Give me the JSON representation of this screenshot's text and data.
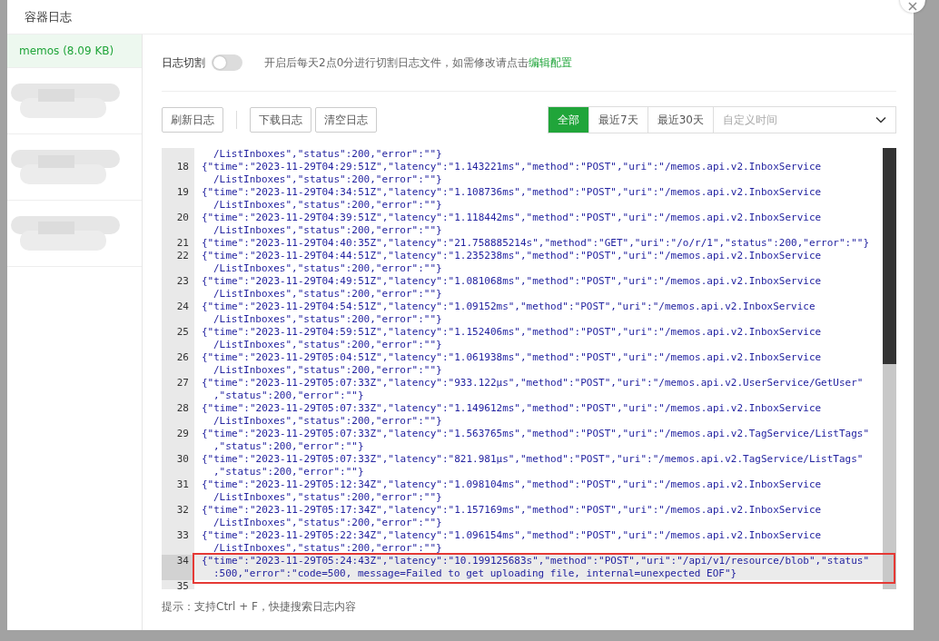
{
  "dialog": {
    "title": "容器日志"
  },
  "sidebar": {
    "items": [
      {
        "kind": "container",
        "name": "memos",
        "size": "(8.09 KB)",
        "selected": true
      },
      {
        "kind": "redacted",
        "selected": false
      },
      {
        "kind": "redacted",
        "selected": false
      },
      {
        "kind": "redacted",
        "selected": false
      }
    ]
  },
  "log_split": {
    "label": "日志切割",
    "on": false,
    "hint": "开启后每天2点0分进行切割日志文件，如需修改请点击",
    "link": "编辑配置"
  },
  "action_groups": [
    [
      "刷新日志"
    ],
    [
      "下载日志",
      "清空日志"
    ]
  ],
  "ranges": [
    {
      "label": "全部",
      "selected": true
    },
    {
      "label": "最近7天",
      "selected": false
    },
    {
      "label": "最近30天",
      "selected": false
    }
  ],
  "custom_time": {
    "placeholder": "自定义时间"
  },
  "log_lines": [
    {
      "highlighted": false,
      "segments": [
        "/ListInboxes\",\"status\":200,\"error\":\"\"}"
      ]
    },
    {
      "number": "18",
      "highlighted": false,
      "segments": [
        "{\"time\":\"2023-11-29T04:29:51Z\",\"latency\":\"1.143221ms\",\"method\":\"POST\",\"uri\":\"/memos.api.v2.InboxService",
        "/ListInboxes\",\"status\":200,\"error\":\"\"}"
      ]
    },
    {
      "number": "19",
      "highlighted": false,
      "segments": [
        "{\"time\":\"2023-11-29T04:34:51Z\",\"latency\":\"1.108736ms\",\"method\":\"POST\",\"uri\":\"/memos.api.v2.InboxService",
        "/ListInboxes\",\"status\":200,\"error\":\"\"}"
      ]
    },
    {
      "number": "20",
      "highlighted": false,
      "segments": [
        "{\"time\":\"2023-11-29T04:39:51Z\",\"latency\":\"1.118442ms\",\"method\":\"POST\",\"uri\":\"/memos.api.v2.InboxService",
        "/ListInboxes\",\"status\":200,\"error\":\"\"}"
      ]
    },
    {
      "number": "21",
      "highlighted": false,
      "segments": [
        "{\"time\":\"2023-11-29T04:40:35Z\",\"latency\":\"21.758885214s\",\"method\":\"GET\",\"uri\":\"/o/r/1\",\"status\":200,\"error\":\"\"}"
      ]
    },
    {
      "number": "22",
      "highlighted": false,
      "segments": [
        "{\"time\":\"2023-11-29T04:44:51Z\",\"latency\":\"1.235238ms\",\"method\":\"POST\",\"uri\":\"/memos.api.v2.InboxService",
        "/ListInboxes\",\"status\":200,\"error\":\"\"}"
      ]
    },
    {
      "number": "23",
      "highlighted": false,
      "segments": [
        "{\"time\":\"2023-11-29T04:49:51Z\",\"latency\":\"1.081068ms\",\"method\":\"POST\",\"uri\":\"/memos.api.v2.InboxService",
        "/ListInboxes\",\"status\":200,\"error\":\"\"}"
      ]
    },
    {
      "number": "24",
      "highlighted": false,
      "segments": [
        "{\"time\":\"2023-11-29T04:54:51Z\",\"latency\":\"1.09152ms\",\"method\":\"POST\",\"uri\":\"/memos.api.v2.InboxService",
        "/ListInboxes\",\"status\":200,\"error\":\"\"}"
      ]
    },
    {
      "number": "25",
      "highlighted": false,
      "segments": [
        "{\"time\":\"2023-11-29T04:59:51Z\",\"latency\":\"1.152406ms\",\"method\":\"POST\",\"uri\":\"/memos.api.v2.InboxService",
        "/ListInboxes\",\"status\":200,\"error\":\"\"}"
      ]
    },
    {
      "number": "26",
      "highlighted": false,
      "segments": [
        "{\"time\":\"2023-11-29T05:04:51Z\",\"latency\":\"1.061938ms\",\"method\":\"POST\",\"uri\":\"/memos.api.v2.InboxService",
        "/ListInboxes\",\"status\":200,\"error\":\"\"}"
      ]
    },
    {
      "number": "27",
      "highlighted": false,
      "segments": [
        "{\"time\":\"2023-11-29T05:07:33Z\",\"latency\":\"933.122µs\",\"method\":\"POST\",\"uri\":\"/memos.api.v2.UserService/GetUser\"",
        ",\"status\":200,\"error\":\"\"}"
      ]
    },
    {
      "number": "28",
      "highlighted": false,
      "segments": [
        "{\"time\":\"2023-11-29T05:07:33Z\",\"latency\":\"1.149612ms\",\"method\":\"POST\",\"uri\":\"/memos.api.v2.InboxService",
        "/ListInboxes\",\"status\":200,\"error\":\"\"}"
      ]
    },
    {
      "number": "29",
      "highlighted": false,
      "segments": [
        "{\"time\":\"2023-11-29T05:07:33Z\",\"latency\":\"1.563765ms\",\"method\":\"POST\",\"uri\":\"/memos.api.v2.TagService/ListTags\"",
        ",\"status\":200,\"error\":\"\"}"
      ]
    },
    {
      "number": "30",
      "highlighted": false,
      "segments": [
        "{\"time\":\"2023-11-29T05:07:33Z\",\"latency\":\"821.981µs\",\"method\":\"POST\",\"uri\":\"/memos.api.v2.TagService/ListTags\"",
        ",\"status\":200,\"error\":\"\"}"
      ]
    },
    {
      "number": "31",
      "highlighted": false,
      "segments": [
        "{\"time\":\"2023-11-29T05:12:34Z\",\"latency\":\"1.098104ms\",\"method\":\"POST\",\"uri\":\"/memos.api.v2.InboxService",
        "/ListInboxes\",\"status\":200,\"error\":\"\"}"
      ]
    },
    {
      "number": "32",
      "highlighted": false,
      "segments": [
        "{\"time\":\"2023-11-29T05:17:34Z\",\"latency\":\"1.157169ms\",\"method\":\"POST\",\"uri\":\"/memos.api.v2.InboxService",
        "/ListInboxes\",\"status\":200,\"error\":\"\"}"
      ]
    },
    {
      "number": "33",
      "highlighted": false,
      "segments": [
        "{\"time\":\"2023-11-29T05:22:34Z\",\"latency\":\"1.096154ms\",\"method\":\"POST\",\"uri\":\"/memos.api.v2.InboxService",
        "/ListInboxes\",\"status\":200,\"error\":\"\"}"
      ]
    },
    {
      "number": "34",
      "highlighted": true,
      "segments": [
        "{\"time\":\"2023-11-29T05:24:43Z\",\"latency\":\"10.199125683s\",\"method\":\"POST\",\"uri\":\"/api/v1/resource/blob\",\"status\"",
        ":500,\"error\":\"code=500, message=Failed to get uploading file, internal=unexpected EOF\"}"
      ]
    },
    {
      "number": "35",
      "highlighted": false
    }
  ],
  "tip": "提示：支持Ctrl + F，快捷搜索日志内容"
}
